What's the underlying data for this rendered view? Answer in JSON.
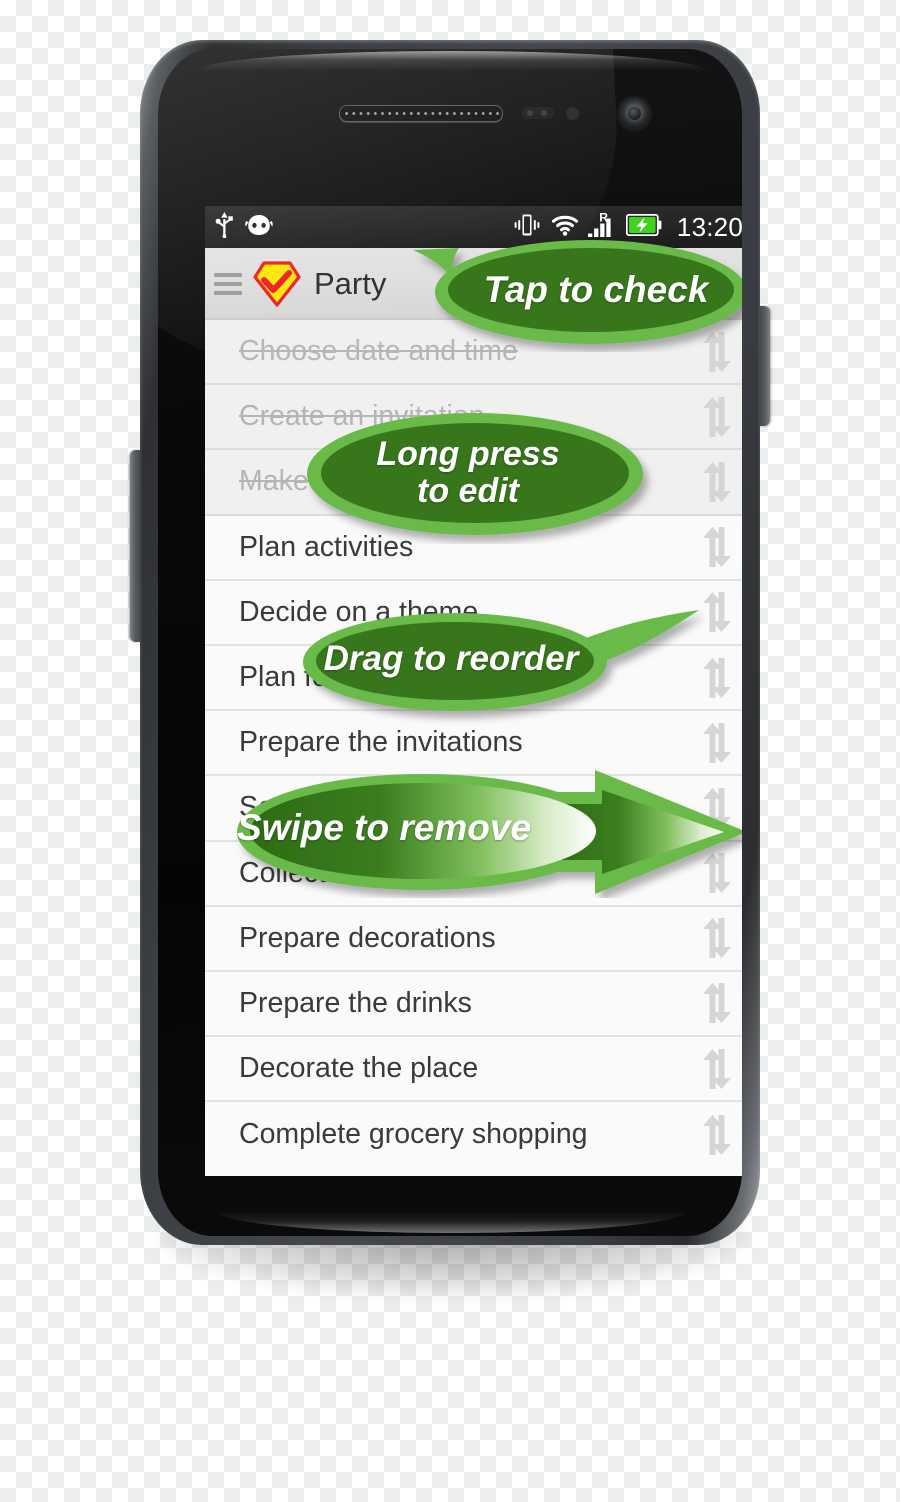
{
  "status_bar": {
    "left_icons": [
      "usb-icon",
      "android-head-icon"
    ],
    "right_icons": [
      "vibrate-icon",
      "wifi-icon",
      "roaming-signal-icon",
      "battery-charging-icon"
    ],
    "roaming_label": "R",
    "clock": "13:20"
  },
  "action_bar": {
    "drawer_icon": "hamburger-menu-icon",
    "app_logo_icon": "checkmark-shield-logo-icon",
    "title": "Party",
    "actions": [
      {
        "name": "lock-button",
        "icon": "unlock-padlock-icon"
      },
      {
        "name": "collapse-button",
        "icon": "collapse-arrows-icon"
      },
      {
        "name": "add-button",
        "icon": "plus-icon"
      },
      {
        "name": "overflow-button",
        "icon": "overflow-menu-icon"
      }
    ]
  },
  "list": {
    "drag_handle_icon": "up-down-arrows-drag-icon",
    "items": [
      {
        "label": "Choose date and time",
        "done": true
      },
      {
        "label": "Create an invitation",
        "done": true
      },
      {
        "label": "Make a list of guests",
        "done": true
      },
      {
        "label": "Plan activities",
        "done": false
      },
      {
        "label": "Decide on a theme",
        "done": false
      },
      {
        "label": "Plan food and drinks",
        "done": false
      },
      {
        "label": "Prepare the invitations",
        "done": false
      },
      {
        "label": "Send out invitations",
        "done": false
      },
      {
        "label": "Collect confirmations",
        "done": false
      },
      {
        "label": "Prepare decorations",
        "done": false
      },
      {
        "label": "Prepare the drinks",
        "done": false
      },
      {
        "label": "Decorate the place",
        "done": false
      },
      {
        "label": "Complete grocery shopping",
        "done": false
      }
    ]
  },
  "callouts": [
    {
      "name": "callout-tap-to-check",
      "text": "Tap to check",
      "shape": "speech-bubble-pointer-left"
    },
    {
      "name": "callout-long-press",
      "text": "Long press\nto edit",
      "shape": "ellipse"
    },
    {
      "name": "callout-drag-to-reorder",
      "text": "Drag to reorder",
      "shape": "speech-bubble-pointer-right"
    },
    {
      "name": "callout-swipe-to-remove",
      "text": "Swipe to remove",
      "shape": "ellipse-with-right-arrow"
    }
  ],
  "colors": {
    "callout_fill_dark": "#38761d",
    "callout_outline_light": "#6aba4a",
    "accent_green": "#61b046",
    "logo_yellow": "#ffe800",
    "logo_red": "#ee1b24",
    "battery_green": "#3fd41b",
    "statusbar_bg": "#232323",
    "actionbar_bg": "#dedede",
    "list_bg": "#fafafa",
    "row_text": "#3a3a3a",
    "row_text_done": "#b5b5b5",
    "divider": "#e3e3e3"
  }
}
